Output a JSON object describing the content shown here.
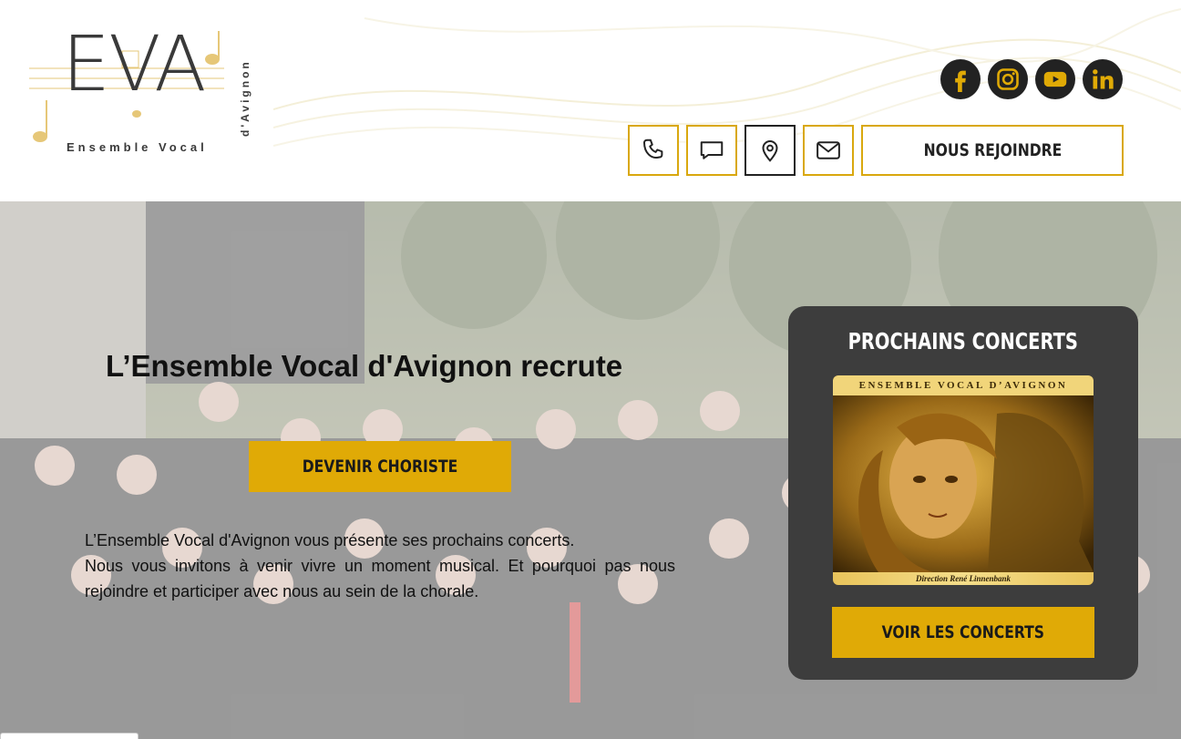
{
  "logo": {
    "letters": "EVA",
    "subtitle": "Ensemble Vocal",
    "vertical": "d'Avignon"
  },
  "socials": [
    {
      "icon": "facebook-icon"
    },
    {
      "icon": "instagram-icon"
    },
    {
      "icon": "youtube-icon"
    },
    {
      "icon": "linkedin-icon"
    }
  ],
  "contact_buttons": [
    {
      "icon": "phone-icon"
    },
    {
      "icon": "chat-icon"
    },
    {
      "icon": "location-pin-icon"
    },
    {
      "icon": "mail-icon"
    }
  ],
  "header": {
    "join_label": "NOUS REJOINDRE"
  },
  "hero": {
    "title": "L’Ensemble Vocal d'Avignon recrute",
    "cta_label": "DEVENIR CHORISTE",
    "text_line1": "L’Ensemble Vocal d'Avignon vous présente ses prochains concerts.",
    "text_line2": "Nous vous invitons à venir vivre un moment musical. Et pourquoi pas nous rejoindre et participer avec nous au sein de la chorale."
  },
  "concerts": {
    "title": "PROCHAINS CONCERTS",
    "poster_header": "ENSEMBLE VOCAL D’AVIGNON",
    "poster_footer": "Direction René Linnenbank",
    "button_label": "VOIR LES CONCERTS"
  },
  "colors": {
    "accent": "#e0aa06",
    "border_gold": "#d9a80e",
    "dark": "#3d3d3d"
  }
}
